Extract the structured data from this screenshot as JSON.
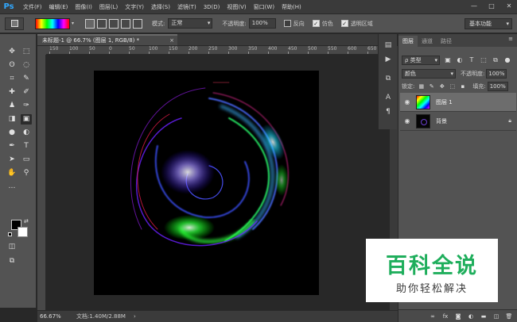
{
  "app": {
    "logo": "Ps"
  },
  "menu": [
    "文件(F)",
    "编辑(E)",
    "图像(I)",
    "图层(L)",
    "文字(Y)",
    "选择(S)",
    "滤镜(T)",
    "3D(D)",
    "视图(V)",
    "窗口(W)",
    "帮助(H)"
  ],
  "window_controls": {
    "minimize": "—",
    "maximize": "□",
    "close": "✕"
  },
  "options": {
    "mode_label": "模式:",
    "mode_value": "正常",
    "opacity_label": "不透明度:",
    "opacity_value": "100%",
    "reverse_label": "反向",
    "dither_label": "仿色",
    "transparency_label": "透明区域",
    "workspace": "基本功能"
  },
  "document": {
    "tab_title": "未标题-1 @ 66.7% (图层 1, RGB/8) *",
    "close": "×",
    "ruler_ticks": [
      "150",
      "100",
      "50",
      "0",
      "50",
      "100",
      "150",
      "200",
      "250",
      "300",
      "350",
      "400",
      "450",
      "500",
      "550",
      "600",
      "650"
    ]
  },
  "status": {
    "zoom": "66.67%",
    "doc_info": "文档:1.40M/2.88M",
    "arrow": "›"
  },
  "layers_panel": {
    "tabs": [
      "图层",
      "通道",
      "路径"
    ],
    "filter_kind": "ρ 类型",
    "blend_mode": "颜色",
    "opacity_label": "不透明度:",
    "opacity_value": "100%",
    "lock_label": "锁定:",
    "fill_label": "填充:",
    "fill_value": "100%",
    "layers": [
      {
        "name": "图层 1",
        "selected": true
      },
      {
        "name": "背景",
        "selected": false,
        "locked": true
      }
    ],
    "bottom_icons": [
      "link-icon",
      "fx-icon",
      "mask-icon",
      "adjustment-icon",
      "folder-icon",
      "new-layer-icon",
      "trash-icon"
    ]
  },
  "watermark": {
    "title": "百科全说",
    "subtitle": "助你轻松解决"
  },
  "colors": {
    "accent": "#31a8ff",
    "watermark_green": "#1fae5c"
  }
}
